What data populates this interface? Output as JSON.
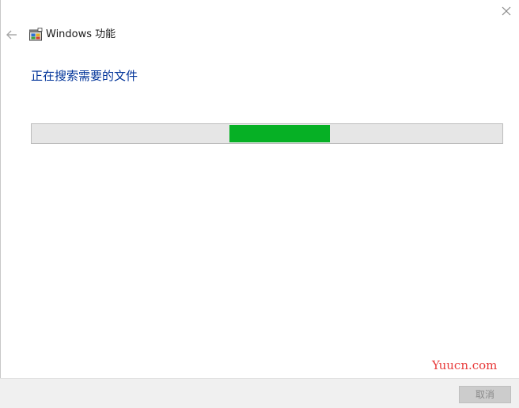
{
  "window": {
    "title": "Windows 功能",
    "icons": {
      "close": "close-icon",
      "back": "back-arrow-icon",
      "app": "windows-features-icon"
    }
  },
  "main": {
    "heading": "正在搜索需要的文件",
    "progress": {
      "mode": "indeterminate",
      "color": "#06b025"
    }
  },
  "watermark": "Yuucn.com",
  "footer": {
    "cancel_label": "取消",
    "cancel_enabled": false
  },
  "colors": {
    "heading": "#003399",
    "progress_track": "#e6e6e6",
    "footer_bg": "#f0f0f0",
    "watermark": "#e83a3a"
  }
}
